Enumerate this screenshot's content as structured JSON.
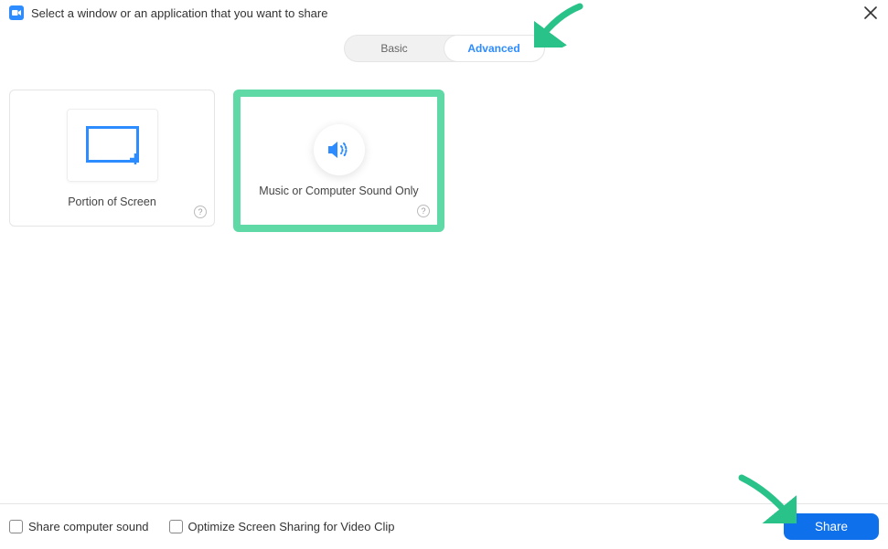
{
  "header": {
    "title": "Select a window or an application that you want to share"
  },
  "tabs": {
    "basic": "Basic",
    "advanced": "Advanced"
  },
  "cards": {
    "portion": {
      "label": "Portion of Screen"
    },
    "sound": {
      "label": "Music or Computer Sound Only"
    }
  },
  "footer": {
    "share_sound": "Share computer sound",
    "optimize": "Optimize Screen Sharing for Video Clip",
    "share_btn": "Share"
  }
}
